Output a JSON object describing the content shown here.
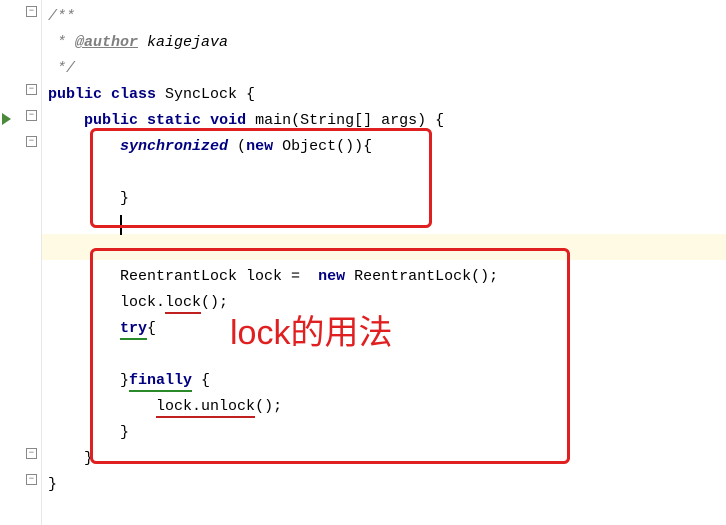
{
  "code": {
    "commentStart": "/**",
    "commentAuthor": " * ",
    "docTag": "@author",
    "authorName": " kaigejava",
    "commentEnd": " */",
    "classDecl": {
      "pub": "public",
      "cls": "class",
      "name": " SyncLock {"
    },
    "mainDecl": {
      "pub": "public",
      "stat": "static",
      "voidKw": "void",
      "main": " main",
      "params": "(String[] args) {"
    },
    "syncLine": {
      "sync": "synchronized",
      "open": " (",
      "newKw": "new",
      "obj": " Object()){"
    },
    "emptyLine": "",
    "closeBrace": "}",
    "reentrantLine": {
      "left": "ReentrantLock lock =  ",
      "newKw": "new",
      "right": " ReentrantLock();"
    },
    "lockCall": {
      "obj": "lock.",
      "method": "lock",
      "tail": "();"
    },
    "tryLine": {
      "tryKw": "try",
      "brace": "{"
    },
    "finallyLine": {
      "close": "}",
      "finKw": "finally",
      "brace": " {"
    },
    "unlockLine": {
      "obj": "lock.",
      "method": "unlock",
      "tail": "();"
    },
    "closeBrace2": "}",
    "closeBrace3": "}",
    "closeBrace4": "}"
  },
  "annotation": {
    "label": "lock的用法"
  }
}
